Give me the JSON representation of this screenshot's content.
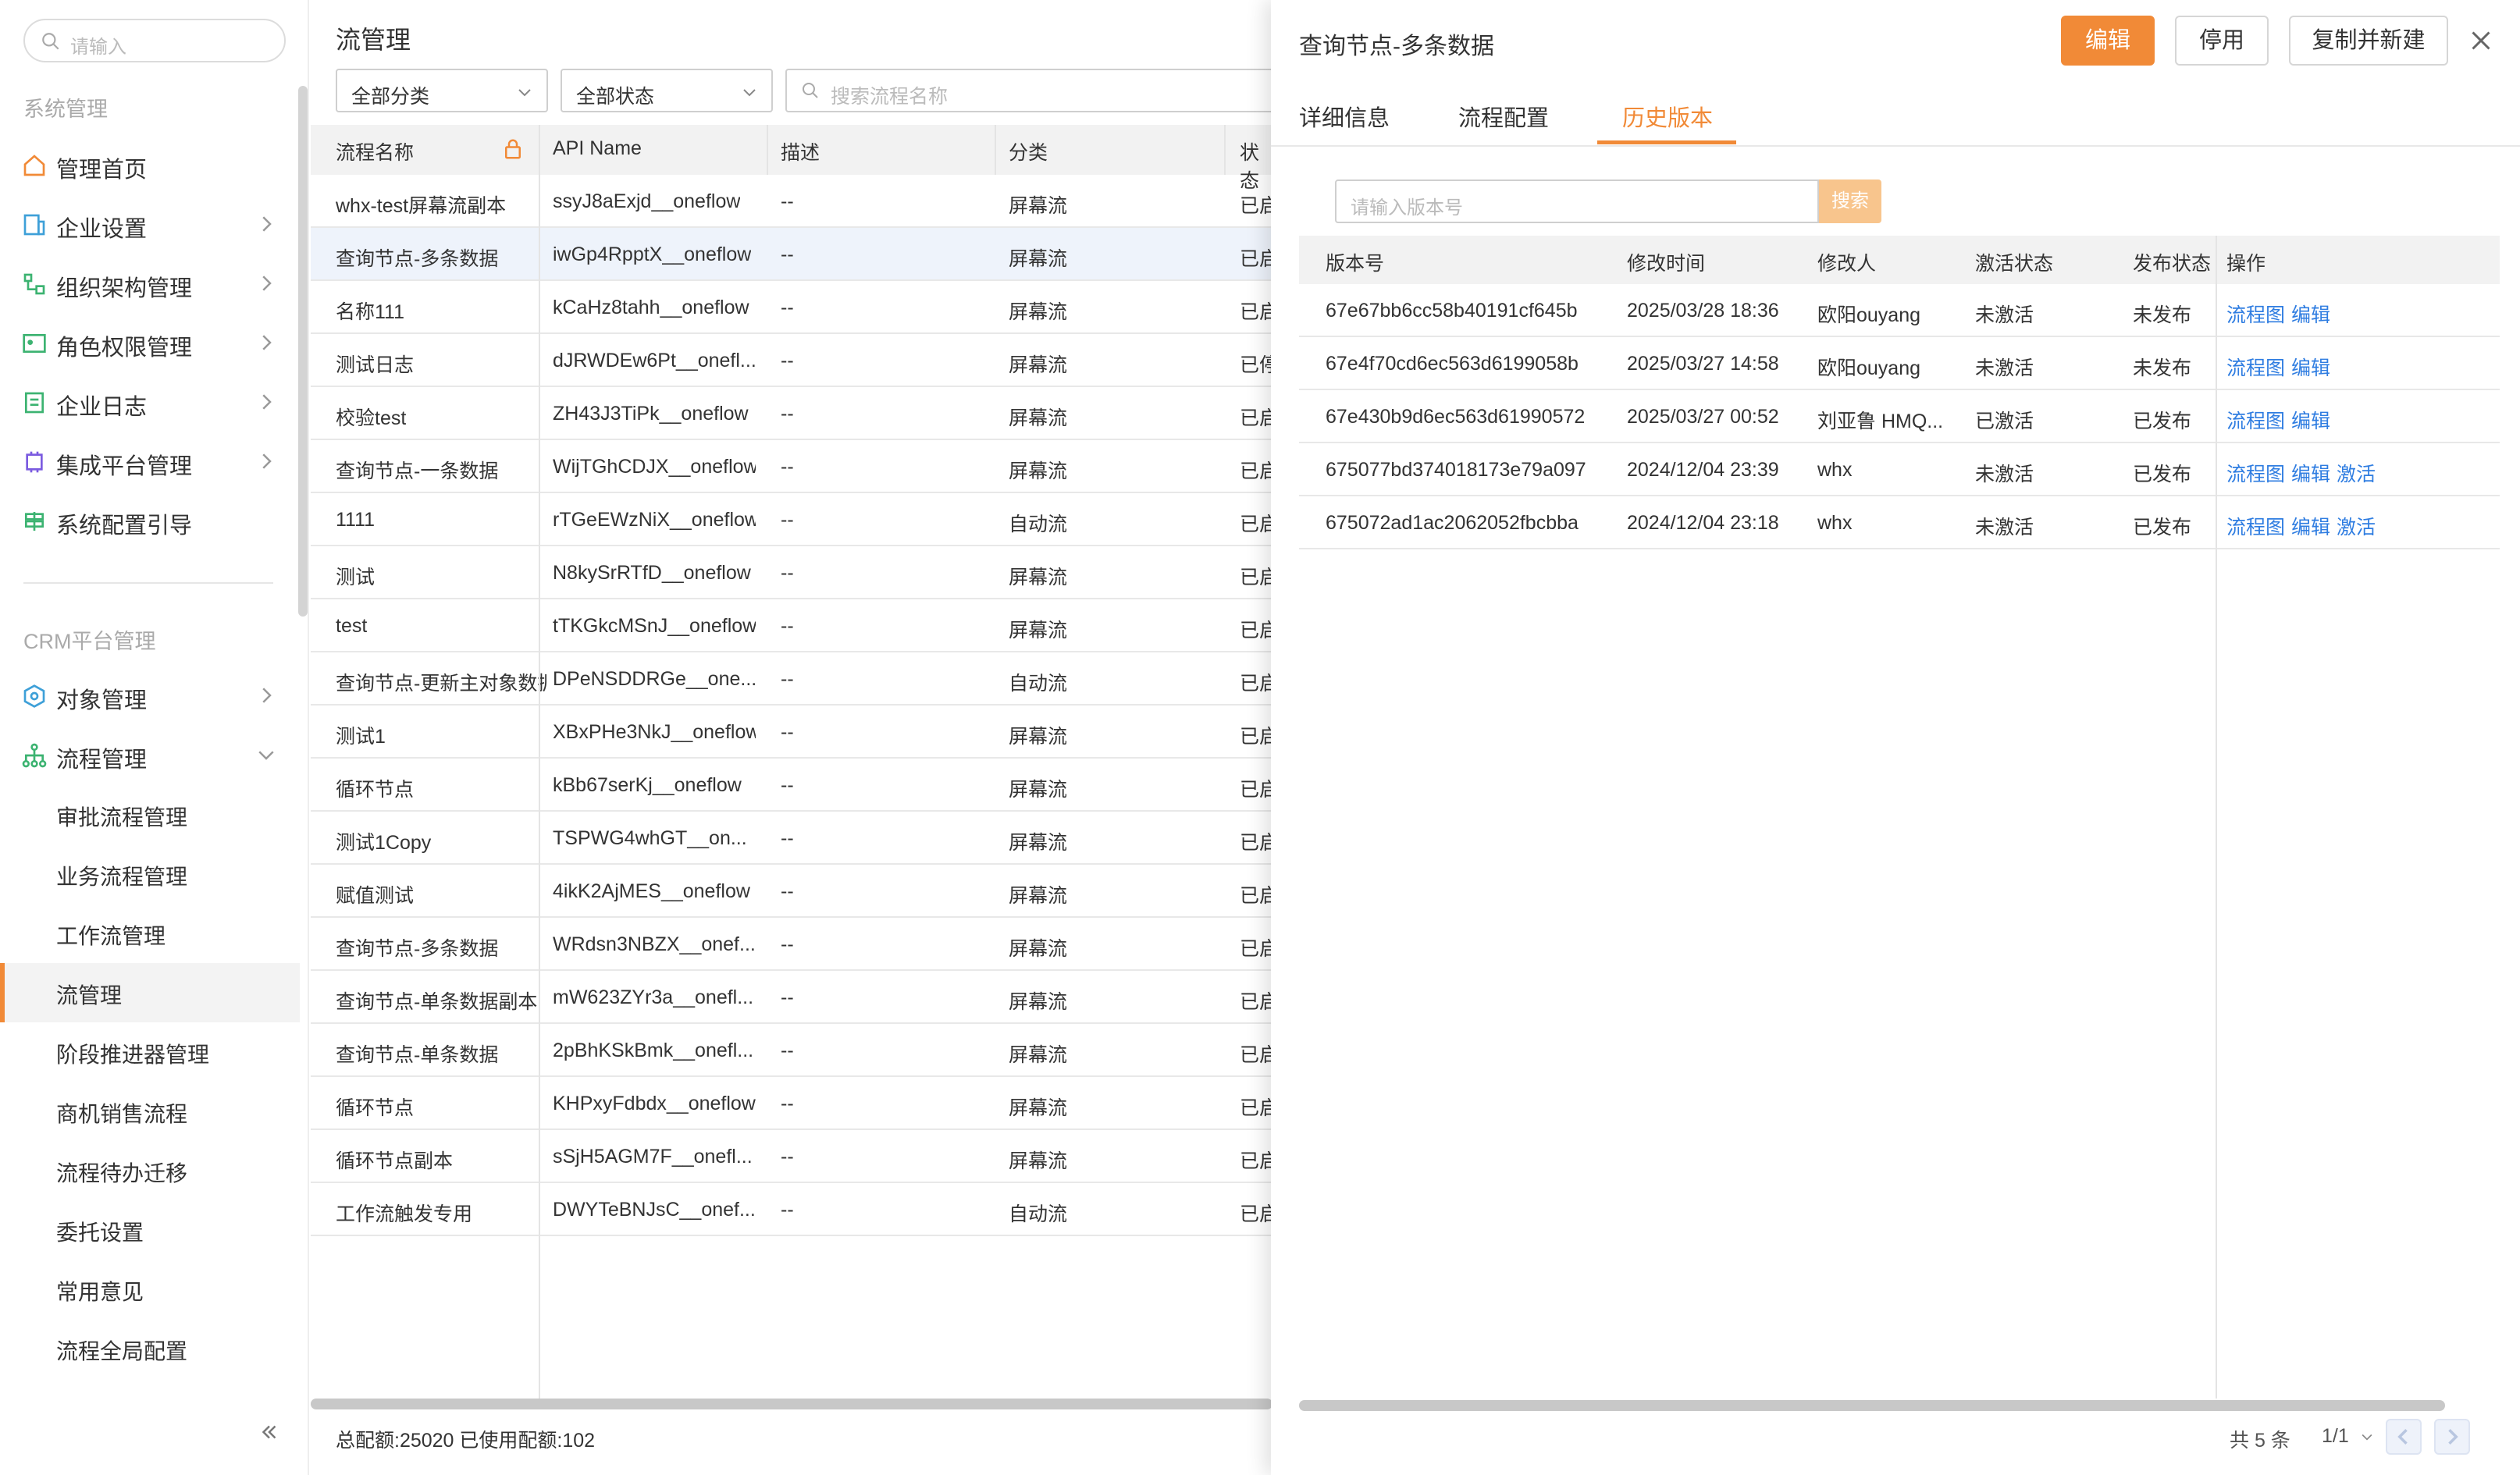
{
  "sidebar": {
    "search_placeholder": "请输入",
    "section_system": "系统管理",
    "section_crm": "CRM平台管理",
    "system_items": [
      {
        "label": "管理首页"
      },
      {
        "label": "企业设置"
      },
      {
        "label": "组织架构管理"
      },
      {
        "label": "角色权限管理"
      },
      {
        "label": "企业日志"
      },
      {
        "label": "集成平台管理"
      },
      {
        "label": "系统配置引导"
      }
    ],
    "crm_items": [
      {
        "label": "对象管理"
      },
      {
        "label": "流程管理"
      }
    ],
    "flow_sub_items": [
      {
        "label": "审批流程管理"
      },
      {
        "label": "业务流程管理"
      },
      {
        "label": "工作流管理"
      },
      {
        "label": "流管理"
      },
      {
        "label": "阶段推进器管理"
      },
      {
        "label": "商机销售流程"
      },
      {
        "label": "流程待办迁移"
      },
      {
        "label": "委托设置"
      },
      {
        "label": "常用意见"
      },
      {
        "label": "流程全局配置"
      }
    ],
    "active_sub": "流管理"
  },
  "main": {
    "title": "流管理",
    "filter_category": "全部分类",
    "filter_status": "全部状态",
    "search_placeholder": "搜索流程名称",
    "columns": [
      "流程名称",
      "API Name",
      "描述",
      "分类",
      "状态"
    ],
    "rows": [
      {
        "name": "whx-test屏幕流副本",
        "api": "ssyJ8aExjd__oneflow",
        "desc": "--",
        "cat": "屏幕流",
        "status": "已启"
      },
      {
        "name": "查询节点-多条数据",
        "api": "iwGp4RpptX__oneflow",
        "desc": "--",
        "cat": "屏幕流",
        "status": "已启"
      },
      {
        "name": "名称111",
        "api": "kCaHz8tahh__oneflow",
        "desc": "--",
        "cat": "屏幕流",
        "status": "已启"
      },
      {
        "name": "测试日志",
        "api": "dJRWDEw6Pt__onefl...",
        "desc": "--",
        "cat": "屏幕流",
        "status": "已停"
      },
      {
        "name": "校验test",
        "api": "ZH43J3TiPk__oneflow",
        "desc": "--",
        "cat": "屏幕流",
        "status": "已启"
      },
      {
        "name": "查询节点-一条数据",
        "api": "WijTGhCDJX__oneflow",
        "desc": "--",
        "cat": "屏幕流",
        "status": "已启"
      },
      {
        "name": "1111",
        "api": "rTGeEWzNiX__oneflow",
        "desc": "--",
        "cat": "自动流",
        "status": "已启"
      },
      {
        "name": "测试",
        "api": "N8kySrRTfD__oneflow",
        "desc": "--",
        "cat": "屏幕流",
        "status": "已启"
      },
      {
        "name": "test",
        "api": "tTKGkcMSnJ__oneflow",
        "desc": "--",
        "cat": "屏幕流",
        "status": "已启"
      },
      {
        "name": "查询节点-更新主对象数据",
        "api": "DPeNSDDRGe__one...",
        "desc": "--",
        "cat": "自动流",
        "status": "已启"
      },
      {
        "name": "测试1",
        "api": "XBxPHe3NkJ__oneflow",
        "desc": "--",
        "cat": "屏幕流",
        "status": "已启"
      },
      {
        "name": "循环节点",
        "api": "kBb67serKj__oneflow",
        "desc": "--",
        "cat": "屏幕流",
        "status": "已启"
      },
      {
        "name": "测试1Copy",
        "api": "TSPWG4whGT__on...",
        "desc": "--",
        "cat": "屏幕流",
        "status": "已启"
      },
      {
        "name": "赋值测试",
        "api": "4ikK2AjMES__oneflow",
        "desc": "--",
        "cat": "屏幕流",
        "status": "已启"
      },
      {
        "name": "查询节点-多条数据",
        "api": "WRdsn3NBZX__onef...",
        "desc": "--",
        "cat": "屏幕流",
        "status": "已启"
      },
      {
        "name": "查询节点-单条数据副本",
        "api": "mW623ZYr3a__onefl...",
        "desc": "--",
        "cat": "屏幕流",
        "status": "已启"
      },
      {
        "name": "查询节点-单条数据",
        "api": "2pBhKSkBmk__onefl...",
        "desc": "--",
        "cat": "屏幕流",
        "status": "已启"
      },
      {
        "name": "循环节点",
        "api": "KHPxyFdbdx__oneflow",
        "desc": "--",
        "cat": "屏幕流",
        "status": "已启"
      },
      {
        "name": "循环节点副本",
        "api": "sSjH5AGM7F__onefl...",
        "desc": "--",
        "cat": "屏幕流",
        "status": "已启"
      },
      {
        "name": "工作流触发专用",
        "api": "DWYTeBNJsC__onef...",
        "desc": "--",
        "cat": "自动流",
        "status": "已启"
      }
    ],
    "selected_row": 1,
    "footer": "总配额:25020 已使用配额:102"
  },
  "drawer": {
    "title": "查询节点-多条数据",
    "btn_edit": "编辑",
    "btn_disable": "停用",
    "btn_copy": "复制并新建",
    "tabs": [
      "详细信息",
      "流程配置",
      "历史版本"
    ],
    "active_tab": "历史版本",
    "version_placeholder": "请输入版本号",
    "search_btn": "搜索",
    "columns": [
      "版本号",
      "修改时间",
      "修改人",
      "激活状态",
      "发布状态",
      "操作"
    ],
    "versions": [
      {
        "id": "67e67bb6cc58b40191cf645b",
        "time": "2025/03/28 18:36",
        "user": "欧阳ouyang",
        "active": "未激活",
        "publish": "未发布",
        "ops": [
          "流程图",
          "编辑"
        ]
      },
      {
        "id": "67e4f70cd6ec563d6199058b",
        "time": "2025/03/27 14:58",
        "user": "欧阳ouyang",
        "active": "未激活",
        "publish": "未发布",
        "ops": [
          "流程图",
          "编辑"
        ]
      },
      {
        "id": "67e430b9d6ec563d61990572",
        "time": "2025/03/27 00:52",
        "user": "刘亚鲁 HMQ...",
        "active": "已激活",
        "publish": "已发布",
        "ops": [
          "流程图",
          "编辑"
        ]
      },
      {
        "id": "675077bd374018173e79a097",
        "time": "2024/12/04 23:39",
        "user": "whx",
        "active": "未激活",
        "publish": "已发布",
        "ops": [
          "流程图",
          "编辑",
          "激活"
        ]
      },
      {
        "id": "675072ad1ac2062052fbcbba",
        "time": "2024/12/04 23:18",
        "user": "whx",
        "active": "未激活",
        "publish": "已发布",
        "ops": [
          "流程图",
          "编辑",
          "激活"
        ]
      }
    ],
    "total": "共 5 条",
    "page": "1/1"
  },
  "colors": {
    "accent": "#f18a37",
    "link": "#2f7de1",
    "icon": "#3ea0d8"
  }
}
